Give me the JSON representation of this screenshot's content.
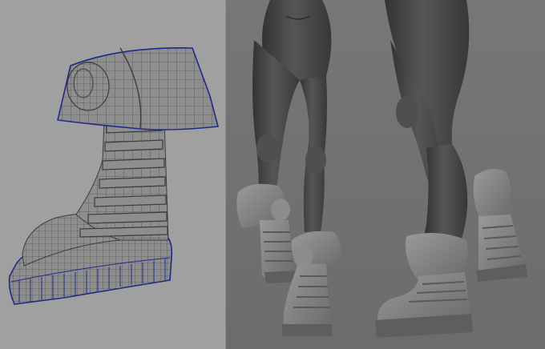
{
  "left_viewport": {
    "view": "wireframe",
    "subject": "boot-mesh",
    "background_color": "#a0a0a0",
    "mesh_fill_color": "#8e8e8e",
    "wire_color": "#3c3c3c",
    "border_wire_color": "#1e2a8a"
  },
  "right_viewport": {
    "view": "shaded",
    "subject": "legs-with-boots",
    "background_color": "#727272",
    "model_color": "#4a4a4a",
    "boot_color": "#8a8a8a"
  }
}
